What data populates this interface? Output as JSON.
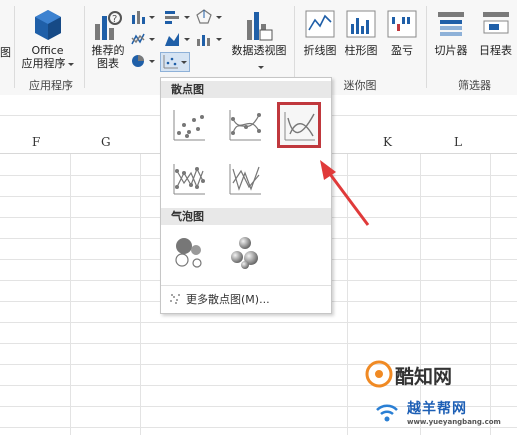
{
  "ribbon": {
    "office_btn": {
      "line1": "Office",
      "line2": "应用程序",
      "group": "应用程序"
    },
    "recommended_charts": {
      "line1": "推荐的",
      "line2": "图表"
    },
    "pivot_chart": {
      "label": "数据透视图"
    },
    "sparklines": {
      "line": "折线图",
      "column": "柱形图",
      "winloss": "盈亏",
      "group": "迷你图"
    },
    "filters": {
      "slicer": "切片器",
      "timeline": "日程表",
      "group": "筛选器"
    },
    "left_cut_label": "图"
  },
  "dropdown": {
    "scatter_header": "散点图",
    "bubble_header": "气泡图",
    "more_label": "更多散点图(M)..."
  },
  "columns": [
    "F",
    "G",
    "K",
    "L"
  ],
  "watermark": {
    "brand": "酷知网",
    "site_cn": "越羊帮网",
    "site_url": "www.yueyangbang.com"
  },
  "colors": {
    "accent_red": "#c0383d",
    "chart_blue": "#1f5fa8"
  }
}
